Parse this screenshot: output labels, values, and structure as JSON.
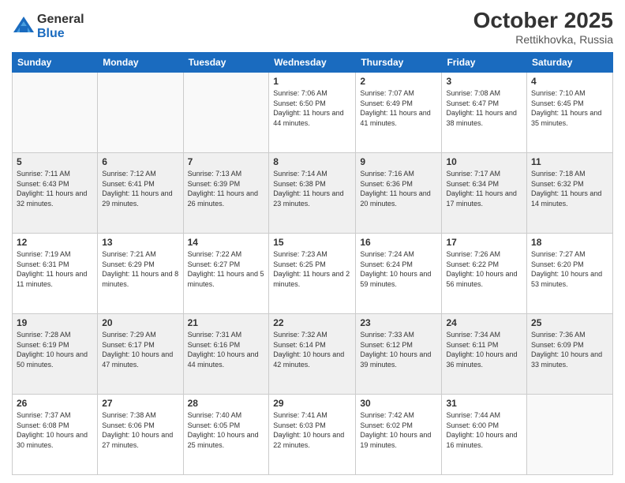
{
  "logo": {
    "general": "General",
    "blue": "Blue"
  },
  "header": {
    "month_year": "October 2025",
    "location": "Rettikhovka, Russia"
  },
  "days_of_week": [
    "Sunday",
    "Monday",
    "Tuesday",
    "Wednesday",
    "Thursday",
    "Friday",
    "Saturday"
  ],
  "weeks": [
    [
      {
        "day": "",
        "info": ""
      },
      {
        "day": "",
        "info": ""
      },
      {
        "day": "",
        "info": ""
      },
      {
        "day": "1",
        "info": "Sunrise: 7:06 AM\nSunset: 6:50 PM\nDaylight: 11 hours\nand 44 minutes."
      },
      {
        "day": "2",
        "info": "Sunrise: 7:07 AM\nSunset: 6:49 PM\nDaylight: 11 hours\nand 41 minutes."
      },
      {
        "day": "3",
        "info": "Sunrise: 7:08 AM\nSunset: 6:47 PM\nDaylight: 11 hours\nand 38 minutes."
      },
      {
        "day": "4",
        "info": "Sunrise: 7:10 AM\nSunset: 6:45 PM\nDaylight: 11 hours\nand 35 minutes."
      }
    ],
    [
      {
        "day": "5",
        "info": "Sunrise: 7:11 AM\nSunset: 6:43 PM\nDaylight: 11 hours\nand 32 minutes."
      },
      {
        "day": "6",
        "info": "Sunrise: 7:12 AM\nSunset: 6:41 PM\nDaylight: 11 hours\nand 29 minutes."
      },
      {
        "day": "7",
        "info": "Sunrise: 7:13 AM\nSunset: 6:39 PM\nDaylight: 11 hours\nand 26 minutes."
      },
      {
        "day": "8",
        "info": "Sunrise: 7:14 AM\nSunset: 6:38 PM\nDaylight: 11 hours\nand 23 minutes."
      },
      {
        "day": "9",
        "info": "Sunrise: 7:16 AM\nSunset: 6:36 PM\nDaylight: 11 hours\nand 20 minutes."
      },
      {
        "day": "10",
        "info": "Sunrise: 7:17 AM\nSunset: 6:34 PM\nDaylight: 11 hours\nand 17 minutes."
      },
      {
        "day": "11",
        "info": "Sunrise: 7:18 AM\nSunset: 6:32 PM\nDaylight: 11 hours\nand 14 minutes."
      }
    ],
    [
      {
        "day": "12",
        "info": "Sunrise: 7:19 AM\nSunset: 6:31 PM\nDaylight: 11 hours\nand 11 minutes."
      },
      {
        "day": "13",
        "info": "Sunrise: 7:21 AM\nSunset: 6:29 PM\nDaylight: 11 hours\nand 8 minutes."
      },
      {
        "day": "14",
        "info": "Sunrise: 7:22 AM\nSunset: 6:27 PM\nDaylight: 11 hours\nand 5 minutes."
      },
      {
        "day": "15",
        "info": "Sunrise: 7:23 AM\nSunset: 6:25 PM\nDaylight: 11 hours\nand 2 minutes."
      },
      {
        "day": "16",
        "info": "Sunrise: 7:24 AM\nSunset: 6:24 PM\nDaylight: 10 hours\nand 59 minutes."
      },
      {
        "day": "17",
        "info": "Sunrise: 7:26 AM\nSunset: 6:22 PM\nDaylight: 10 hours\nand 56 minutes."
      },
      {
        "day": "18",
        "info": "Sunrise: 7:27 AM\nSunset: 6:20 PM\nDaylight: 10 hours\nand 53 minutes."
      }
    ],
    [
      {
        "day": "19",
        "info": "Sunrise: 7:28 AM\nSunset: 6:19 PM\nDaylight: 10 hours\nand 50 minutes."
      },
      {
        "day": "20",
        "info": "Sunrise: 7:29 AM\nSunset: 6:17 PM\nDaylight: 10 hours\nand 47 minutes."
      },
      {
        "day": "21",
        "info": "Sunrise: 7:31 AM\nSunset: 6:16 PM\nDaylight: 10 hours\nand 44 minutes."
      },
      {
        "day": "22",
        "info": "Sunrise: 7:32 AM\nSunset: 6:14 PM\nDaylight: 10 hours\nand 42 minutes."
      },
      {
        "day": "23",
        "info": "Sunrise: 7:33 AM\nSunset: 6:12 PM\nDaylight: 10 hours\nand 39 minutes."
      },
      {
        "day": "24",
        "info": "Sunrise: 7:34 AM\nSunset: 6:11 PM\nDaylight: 10 hours\nand 36 minutes."
      },
      {
        "day": "25",
        "info": "Sunrise: 7:36 AM\nSunset: 6:09 PM\nDaylight: 10 hours\nand 33 minutes."
      }
    ],
    [
      {
        "day": "26",
        "info": "Sunrise: 7:37 AM\nSunset: 6:08 PM\nDaylight: 10 hours\nand 30 minutes."
      },
      {
        "day": "27",
        "info": "Sunrise: 7:38 AM\nSunset: 6:06 PM\nDaylight: 10 hours\nand 27 minutes."
      },
      {
        "day": "28",
        "info": "Sunrise: 7:40 AM\nSunset: 6:05 PM\nDaylight: 10 hours\nand 25 minutes."
      },
      {
        "day": "29",
        "info": "Sunrise: 7:41 AM\nSunset: 6:03 PM\nDaylight: 10 hours\nand 22 minutes."
      },
      {
        "day": "30",
        "info": "Sunrise: 7:42 AM\nSunset: 6:02 PM\nDaylight: 10 hours\nand 19 minutes."
      },
      {
        "day": "31",
        "info": "Sunrise: 7:44 AM\nSunset: 6:00 PM\nDaylight: 10 hours\nand 16 minutes."
      },
      {
        "day": "",
        "info": ""
      }
    ]
  ]
}
